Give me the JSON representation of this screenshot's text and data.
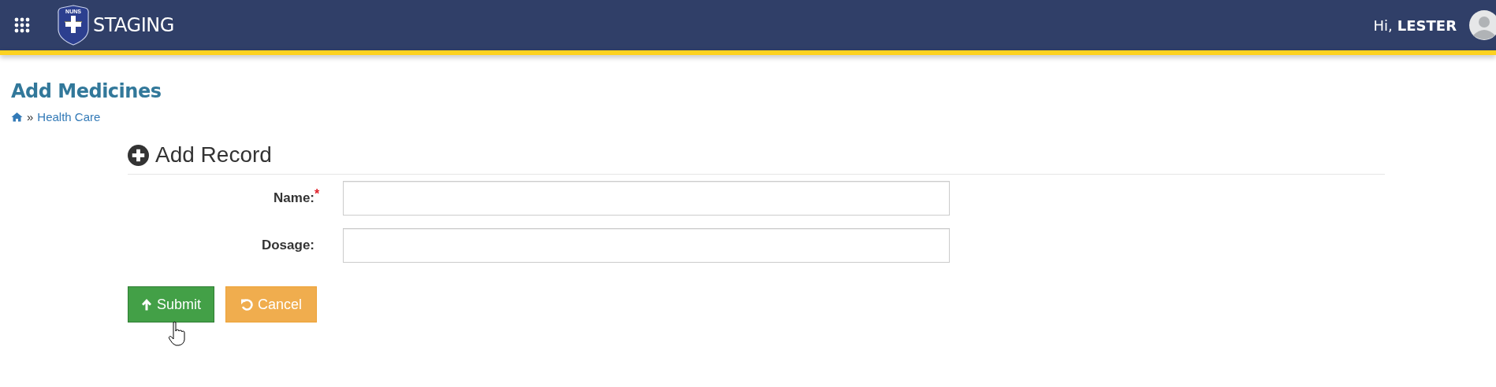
{
  "header": {
    "logo": {
      "top": "NUNS"
    },
    "title": "STAGING",
    "greeting": "Hi,",
    "user": "LESTER"
  },
  "page": {
    "title": "Add Medicines",
    "breadcrumb": [
      {
        "label": "»",
        "kind": "separator"
      },
      {
        "label": "Health Care",
        "kind": "link"
      }
    ]
  },
  "form": {
    "title": "Add Record",
    "required_mark": "*",
    "fields": [
      {
        "label": "Name:",
        "required": true
      },
      {
        "label": "Dosage:",
        "required": false
      }
    ],
    "buttons": [
      {
        "label": "Submit",
        "kind": "submit"
      },
      {
        "label": "Cancel",
        "kind": "cancel"
      }
    ]
  }
}
